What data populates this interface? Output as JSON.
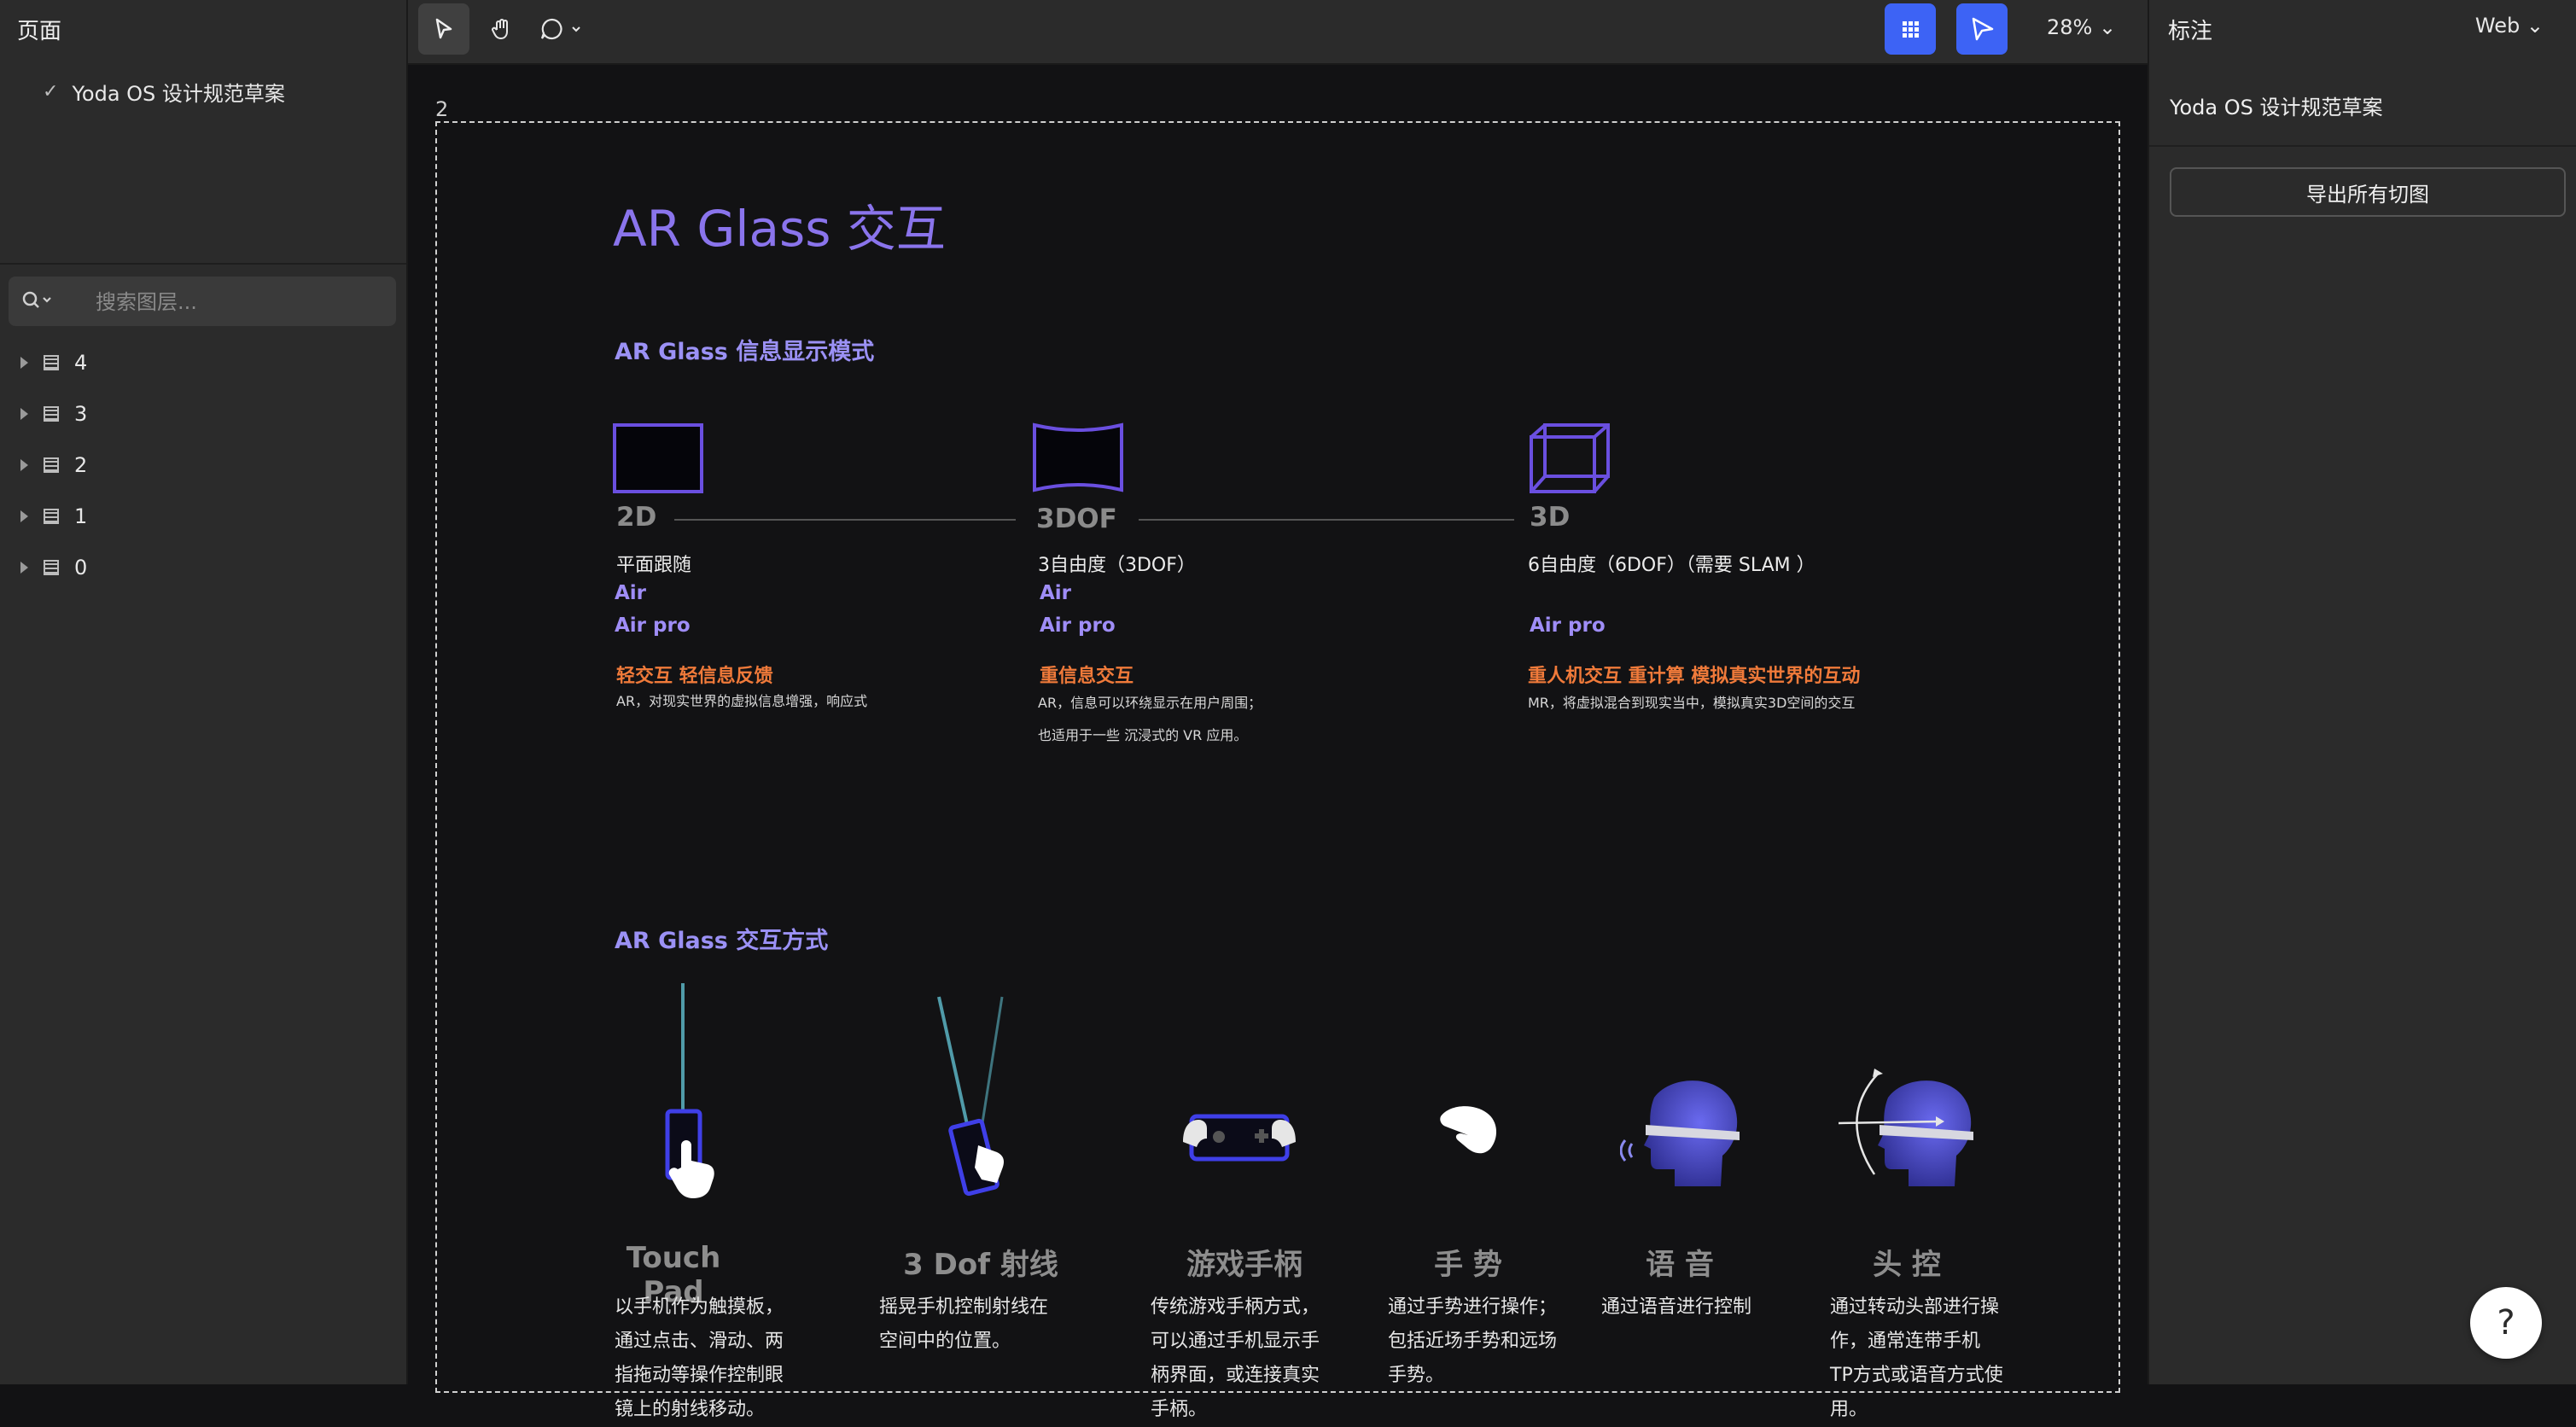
{
  "left_panel": {
    "pages_header": "页面",
    "current_page": "Yoda OS 设计规范草案",
    "search_placeholder": "搜索图层...",
    "layers": [
      "4",
      "3",
      "2",
      "1",
      "0"
    ]
  },
  "toolbar": {
    "zoom": "28%",
    "tools": [
      "move-tool-icon",
      "hand-tool-icon",
      "comment-tool-icon"
    ]
  },
  "right_panel": {
    "header": "标注",
    "platform": "Web",
    "doc_title": "Yoda OS 设计规范草案",
    "export_label": "导出所有切图"
  },
  "canvas": {
    "frame_label": "2",
    "title": "AR Glass 交互",
    "section1": {
      "heading": "AR Glass 信息显示模式",
      "modes": [
        {
          "label": "2D",
          "desc": "平面跟随",
          "devices": [
            "Air",
            "Air pro"
          ],
          "highlight": "轻交互 轻信息反馈",
          "notes": [
            "AR，对现实世界的虚拟信息增强，响应式"
          ]
        },
        {
          "label": "3DOF",
          "desc": "3自由度（3DOF）",
          "devices": [
            "Air",
            "Air pro"
          ],
          "highlight": "重信息交互",
          "notes": [
            "AR，信息可以环绕显示在用户周围；",
            "也适用于一些 沉浸式的 VR 应用。"
          ]
        },
        {
          "label": "3D",
          "desc": "6自由度（6DOF）（需要 SLAM ）",
          "devices": [
            "Air pro"
          ],
          "highlight": "重人机交互 重计算 模拟真实世界的互动",
          "notes": [
            "MR，将虚拟混合到现实当中，模拟真实3D空间的交互"
          ]
        }
      ]
    },
    "section2": {
      "heading": "AR Glass 交互方式",
      "methods": [
        {
          "name": "Touch Pad",
          "icon": "touchpad-hand-icon",
          "desc": [
            "以手机作为触摸板，",
            "通过点击、滑动、两",
            "指拖动等操作控制眼",
            "镜上的射线移动。"
          ]
        },
        {
          "name": "3 Dof 射线",
          "icon": "phone-ray-icon",
          "desc": [
            "摇晃手机控制射线在",
            "空间中的位置。"
          ]
        },
        {
          "name": "游戏手柄",
          "icon": "gamepad-icon",
          "desc": [
            "传统游戏手柄方式，",
            "可以通过手机显示手",
            "柄界面，或连接真实",
            "手柄。"
          ]
        },
        {
          "name": "手 势",
          "icon": "hand-gesture-icon",
          "desc": [
            "通过手势进行操作；",
            "包括近场手势和远场",
            "手势。"
          ]
        },
        {
          "name": "语 音",
          "icon": "voice-head-icon",
          "desc": [
            "通过语音进行控制"
          ]
        },
        {
          "name": "头 控",
          "icon": "head-control-icon",
          "desc": [
            "通过转动头部进行操",
            "作，通常连带手机",
            "TP方式或语音方式使",
            "用。"
          ]
        }
      ]
    }
  },
  "help_label": "?"
}
